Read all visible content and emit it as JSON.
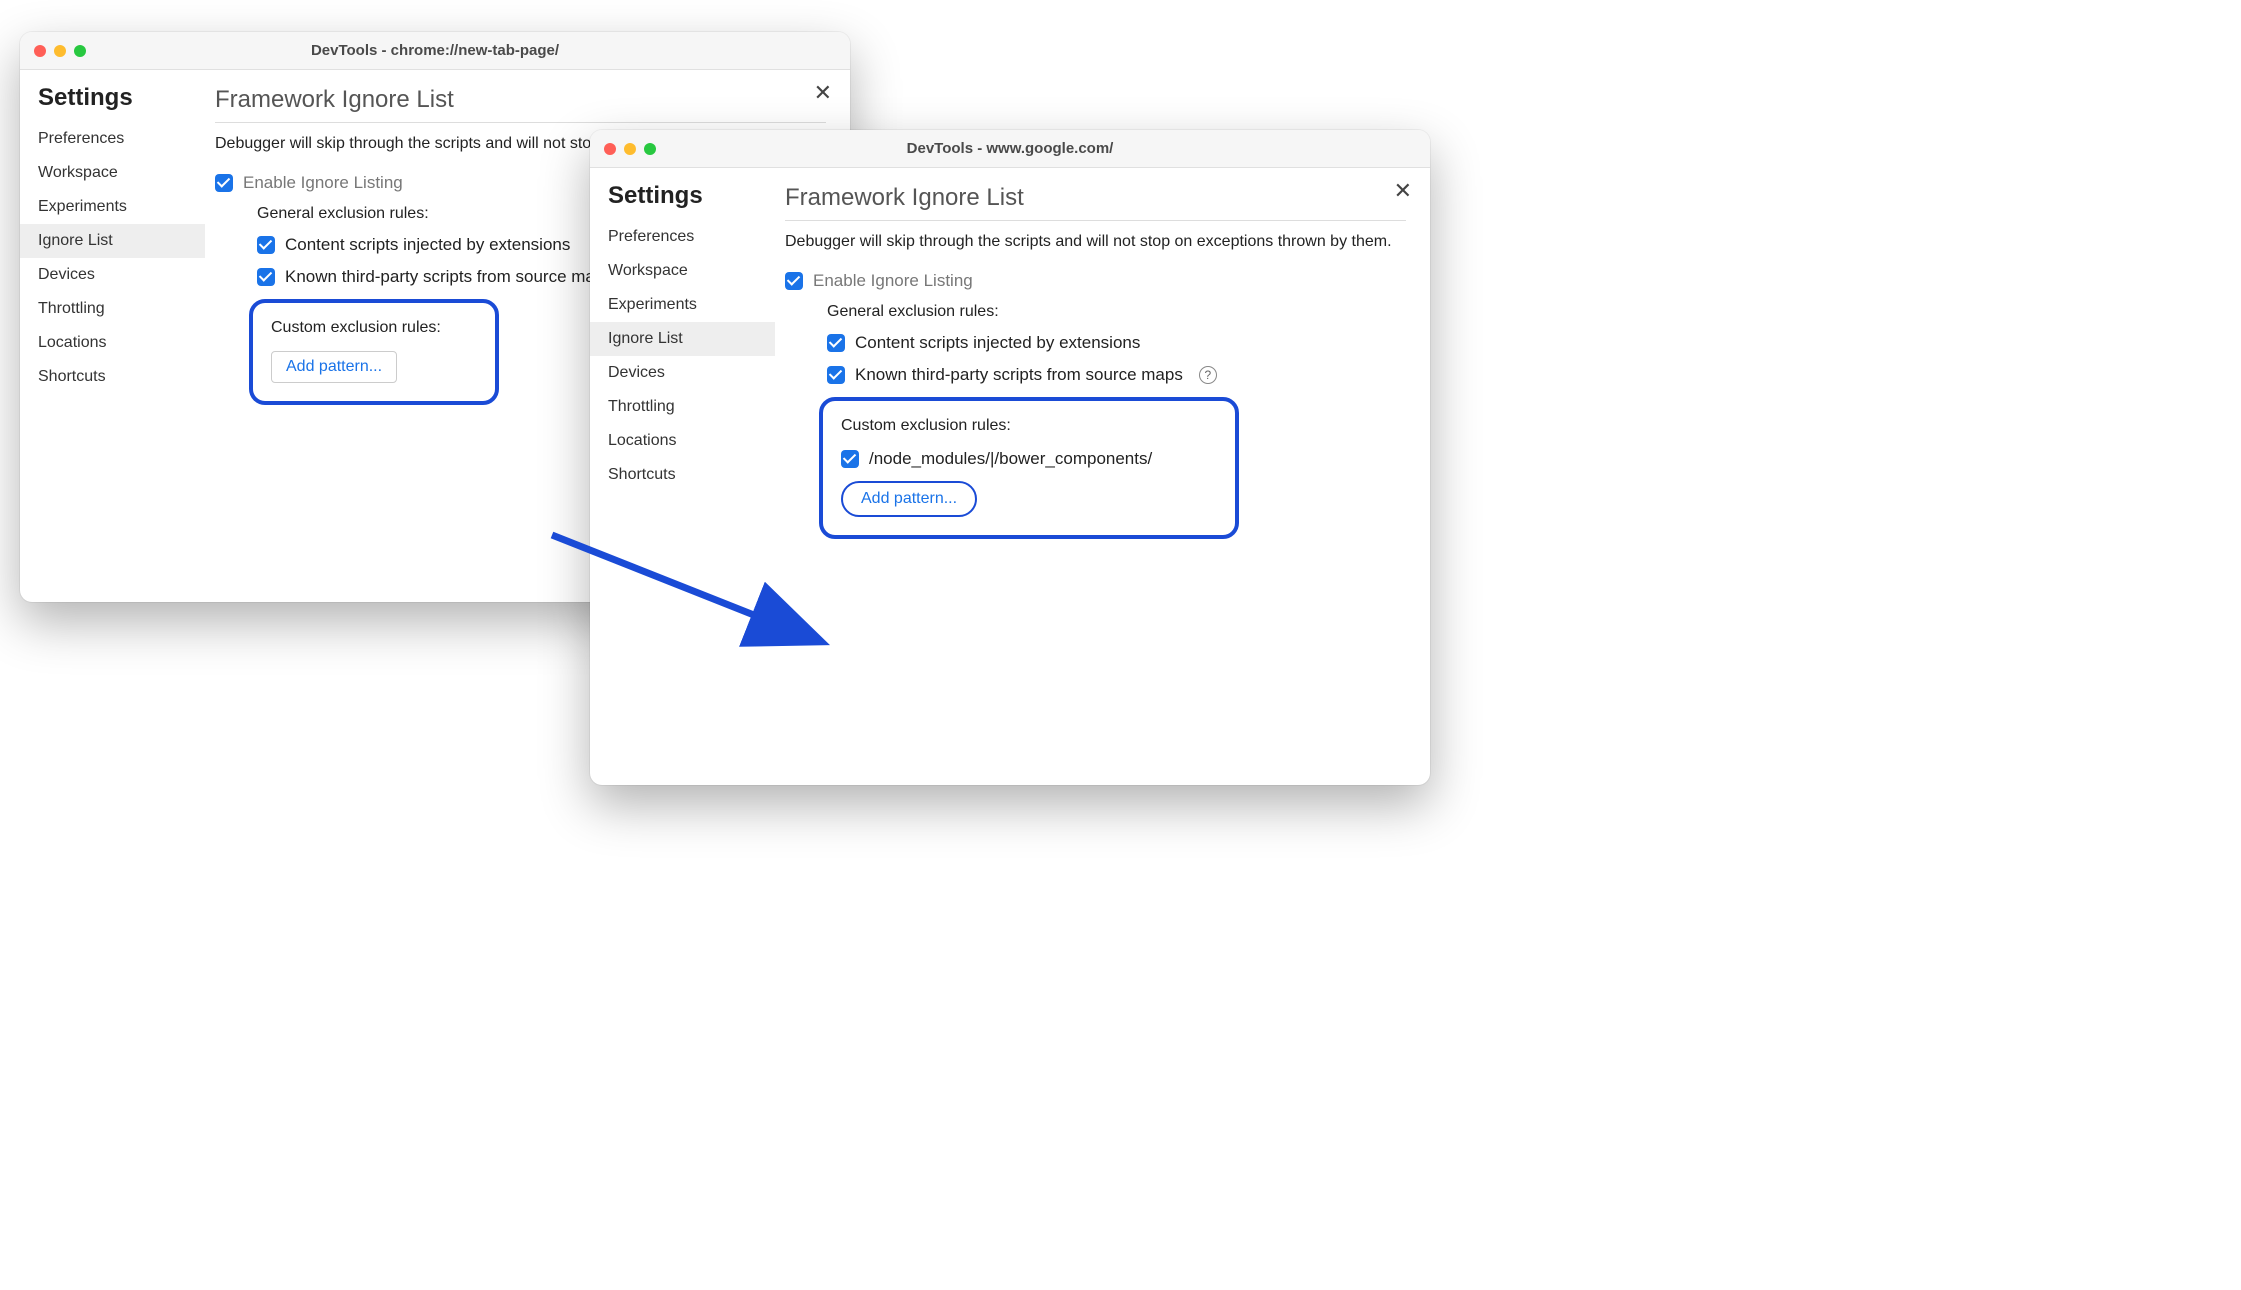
{
  "window1": {
    "title": "DevTools - chrome://new-tab-page/",
    "sidebar": {
      "heading": "Settings",
      "items": [
        "Preferences",
        "Workspace",
        "Experiments",
        "Ignore List",
        "Devices",
        "Throttling",
        "Locations",
        "Shortcuts"
      ],
      "activeIndex": 3
    },
    "content": {
      "heading": "Framework Ignore List",
      "description": "Debugger will skip through the scripts and will not stop on exceptions thrown by them.",
      "enable_label": "Enable Ignore Listing",
      "general_label": "General exclusion rules:",
      "rule_content_scripts": "Content scripts injected by extensions",
      "rule_third_party": "Known third-party scripts from source maps",
      "custom_label": "Custom exclusion rules:",
      "add_button": "Add pattern..."
    }
  },
  "window2": {
    "title": "DevTools - www.google.com/",
    "sidebar": {
      "heading": "Settings",
      "items": [
        "Preferences",
        "Workspace",
        "Experiments",
        "Ignore List",
        "Devices",
        "Throttling",
        "Locations",
        "Shortcuts"
      ],
      "activeIndex": 3
    },
    "content": {
      "heading": "Framework Ignore List",
      "description": "Debugger will skip through the scripts and will not stop on exceptions thrown by them.",
      "enable_label": "Enable Ignore Listing",
      "general_label": "General exclusion rules:",
      "rule_content_scripts": "Content scripts injected by extensions",
      "rule_third_party": "Known third-party scripts from source maps",
      "custom_label": "Custom exclusion rules:",
      "custom_pattern": "/node_modules/|/bower_components/",
      "add_button": "Add pattern..."
    }
  }
}
